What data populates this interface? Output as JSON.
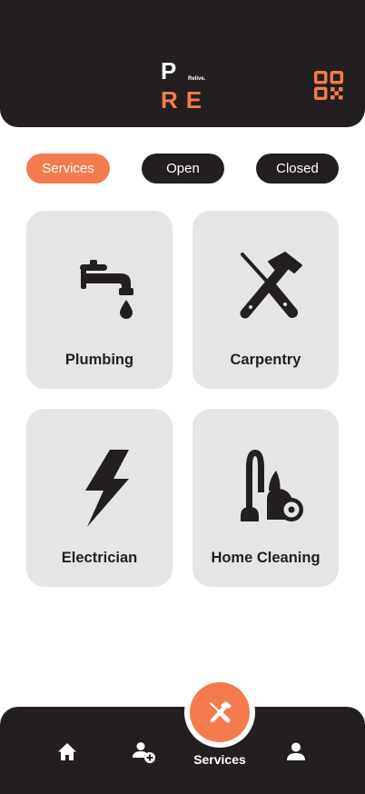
{
  "header": {
    "logo_top": "P",
    "logo_tagline": "Relive.",
    "logo_bottom": "RE"
  },
  "tabs": [
    {
      "label": "Services",
      "active": true
    },
    {
      "label": "Open",
      "active": false
    },
    {
      "label": "Closed",
      "active": false
    }
  ],
  "services": [
    {
      "label": "Plumbing",
      "icon": "faucet-icon"
    },
    {
      "label": "Carpentry",
      "icon": "tools-icon"
    },
    {
      "label": "Electrician",
      "icon": "lightning-icon"
    },
    {
      "label": "Home Cleaning",
      "icon": "vacuum-icon"
    }
  ],
  "bottom_nav": {
    "items": [
      "home-icon",
      "add-user-icon",
      "services-icon",
      "profile-icon"
    ],
    "active_label": "Services"
  },
  "colors": {
    "accent": "#f47b4d",
    "dark": "#231f20",
    "card": "#e5e5e5"
  }
}
